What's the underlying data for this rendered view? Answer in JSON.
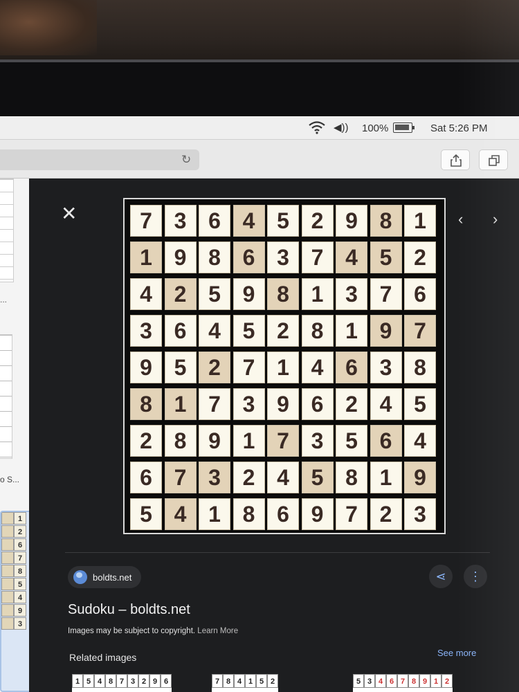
{
  "menubar": {
    "battery_pct": "100%",
    "clock": "Sat 5:26 PM",
    "icons": [
      "wifi-icon",
      "volume-icon",
      "battery-charging-icon"
    ]
  },
  "toolbar": {
    "icons": [
      "reload-icon",
      "share-icon",
      "tabs-icon"
    ]
  },
  "results_strip": {
    "dots": "...",
    "caption": "o S...",
    "mini_digits": [
      "1",
      "2",
      "6",
      "7",
      "8",
      "5",
      "4",
      "9",
      "3"
    ]
  },
  "viewer": {
    "close_icon": "close-icon",
    "nav": [
      "chevron-left-icon",
      "chevron-right-icon"
    ],
    "sudoku": [
      [
        "7",
        "3",
        "6",
        "4",
        "5",
        "2",
        "9",
        "8",
        "1"
      ],
      [
        "1",
        "9",
        "8",
        "6",
        "3",
        "7",
        "4",
        "5",
        "2"
      ],
      [
        "4",
        "2",
        "5",
        "9",
        "8",
        "1",
        "3",
        "7",
        "6"
      ],
      [
        "3",
        "6",
        "4",
        "5",
        "2",
        "8",
        "1",
        "9",
        "7"
      ],
      [
        "9",
        "5",
        "2",
        "7",
        "1",
        "4",
        "6",
        "3",
        "8"
      ],
      [
        "8",
        "1",
        "7",
        "3",
        "9",
        "6",
        "2",
        "4",
        "5"
      ],
      [
        "2",
        "8",
        "9",
        "1",
        "7",
        "3",
        "5",
        "6",
        "4"
      ],
      [
        "6",
        "7",
        "3",
        "2",
        "4",
        "5",
        "8",
        "1",
        "9"
      ],
      [
        "5",
        "4",
        "1",
        "8",
        "6",
        "9",
        "7",
        "2",
        "3"
      ]
    ],
    "shaded_cells": [
      [
        0,
        3
      ],
      [
        0,
        7
      ],
      [
        1,
        0
      ],
      [
        1,
        3
      ],
      [
        1,
        6
      ],
      [
        1,
        7
      ],
      [
        2,
        1
      ],
      [
        2,
        4
      ],
      [
        3,
        7
      ],
      [
        3,
        8
      ],
      [
        4,
        2
      ],
      [
        4,
        6
      ],
      [
        5,
        0
      ],
      [
        5,
        1
      ],
      [
        6,
        4
      ],
      [
        6,
        7
      ],
      [
        7,
        1
      ],
      [
        7,
        2
      ],
      [
        7,
        5
      ],
      [
        7,
        8
      ],
      [
        8,
        1
      ]
    ],
    "source_site": "boldts.net",
    "title": "Sudoku – boldts.net",
    "copyright": "Images may be subject to copyright.",
    "learn_more": "Learn More",
    "related_label": "Related images",
    "see_more": "See more",
    "related_rows": [
      [
        "1",
        "5",
        "4",
        "8",
        "7",
        "3",
        "2",
        "9",
        "6"
      ],
      [
        "7",
        "8",
        "4",
        "1",
        "5",
        "2"
      ],
      [
        "5",
        "3",
        "4",
        "6",
        "7",
        "8",
        "9",
        "1",
        "2"
      ]
    ]
  }
}
